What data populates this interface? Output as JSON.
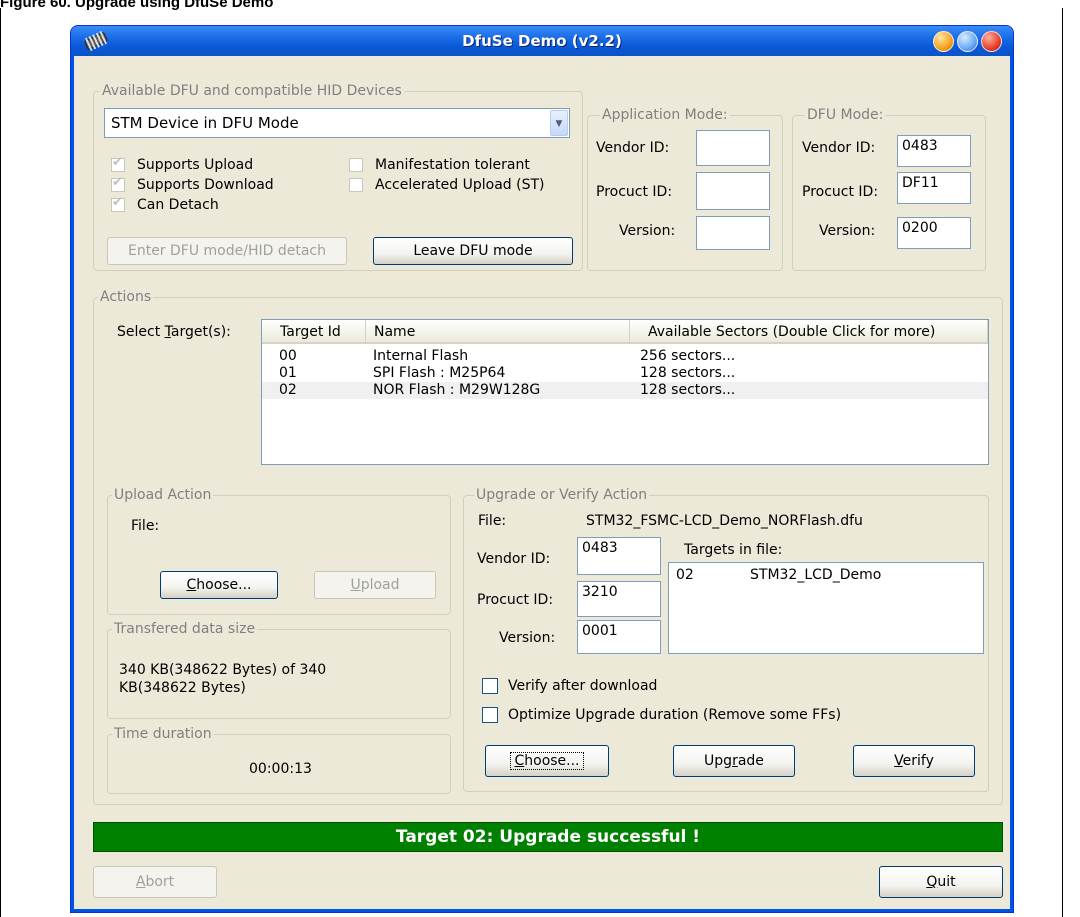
{
  "document": {
    "heading": "Figure 60. Upgrade using DfuSe Demo"
  },
  "window": {
    "title": "DfuSe Demo (v2.2)"
  },
  "devices": {
    "group_title": "Available DFU and compatible HID Devices",
    "selected_device": "STM Device in DFU Mode",
    "checkboxes": {
      "supports_upload": "Supports Upload",
      "supports_download": "Supports Download",
      "can_detach": "Can Detach",
      "manifestation_tolerant": "Manifestation tolerant",
      "accelerated_upload": "Accelerated Upload (ST)"
    },
    "enter_dfu_button": "Enter DFU mode/HID detach",
    "leave_dfu_button": "Leave DFU mode"
  },
  "application_mode": {
    "group_title": "Application Mode:",
    "vendor_label": "Vendor ID:",
    "product_label": "Procuct ID:",
    "version_label": "Version:",
    "vendor_value": "",
    "product_value": "",
    "version_value": ""
  },
  "dfu_mode": {
    "group_title": "DFU Mode:",
    "vendor_label": "Vendor ID:",
    "product_label": "Procuct ID:",
    "version_label": "Version:",
    "vendor_value": "0483",
    "product_value": "DF11",
    "version_value": "0200"
  },
  "actions": {
    "group_title": "Actions",
    "select_targets_label": "Select Target(s):",
    "columns": [
      "Target Id",
      "Name",
      "Available Sectors (Double Click for more)"
    ],
    "rows": [
      {
        "id": "00",
        "name": "Internal Flash",
        "sectors": "256 sectors..."
      },
      {
        "id": "01",
        "name": "SPI Flash : M25P64",
        "sectors": "128 sectors..."
      },
      {
        "id": "02",
        "name": "NOR Flash : M29W128G",
        "sectors": "128 sectors..."
      }
    ]
  },
  "upload_action": {
    "group_title": "Upload Action",
    "file_label": "File:",
    "choose_button": "Choose...",
    "upload_button": "Upload"
  },
  "transferred": {
    "group_title": "Transfered data size",
    "text": "340 KB(348622 Bytes) of 340 KB(348622 Bytes)"
  },
  "time_duration": {
    "group_title": "Time duration",
    "value": "00:00:13"
  },
  "upgrade_action": {
    "group_title": "Upgrade or Verify Action",
    "file_label": "File:",
    "file_name": "STM32_FSMC-LCD_Demo_NORFlash.dfu",
    "vendor_label": "Vendor ID:",
    "vendor_value": "0483",
    "product_label": "Procuct ID:",
    "product_value": "3210",
    "version_label": "Version:",
    "version_value": "0001",
    "targets_label": "Targets in file:",
    "targets": [
      {
        "id": "02",
        "name": "STM32_LCD_Demo"
      }
    ],
    "verify_after_download": "Verify after download",
    "optimize_upgrade": "Optimize Upgrade duration (Remove some FFs)",
    "choose_button": "Choose...",
    "upgrade_button": "Upgrade",
    "verify_button": "Verify"
  },
  "status": {
    "message": "Target 02: Upgrade successful !",
    "color": "#008000"
  },
  "footer": {
    "abort_button": "Abort",
    "quit_button": "Quit"
  }
}
